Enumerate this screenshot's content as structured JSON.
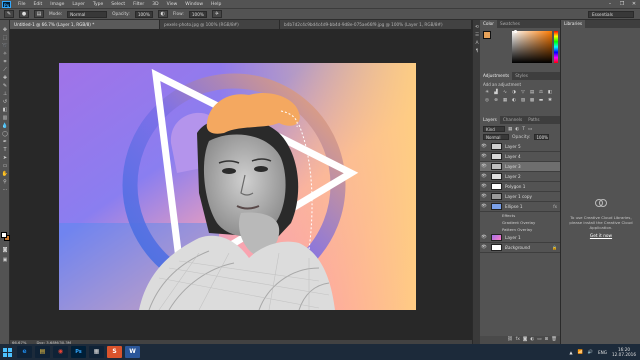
{
  "menubar": {
    "logo": "Ps",
    "items": [
      "File",
      "Edit",
      "Image",
      "Layer",
      "Type",
      "Select",
      "Filter",
      "3D",
      "View",
      "Window",
      "Help"
    ],
    "window_controls": [
      "–",
      "❐",
      "✕"
    ]
  },
  "options": {
    "mode_label": "Mode:",
    "mode_value": "Normal",
    "opacity_label": "Opacity:",
    "opacity_value": "100%",
    "flow_label": "Flow:",
    "flow_value": "100%",
    "workspace": "Essentials"
  },
  "tabs": [
    {
      "label": "Untitled-1 @ 66.7% (Layer 1, RGB/8) *",
      "active": true
    },
    {
      "label": "pexels-photo.jpg @ 100% (RGB/8#)",
      "active": false
    },
    {
      "label": "b4b7d2c4c9bd4c4d9-bb4d-9d8e-075ae66f9.jpg @ 100% (Layer 1, RGB/8#)",
      "active": false
    }
  ],
  "status": {
    "zoom": "66.67%",
    "doc_size": "Doc: 3.68M/30.3M"
  },
  "color_panel": {
    "tabs": [
      "Color",
      "Swatches"
    ],
    "fg_color": "#e8a35a"
  },
  "adjustments": {
    "tabs": [
      "Adjustments",
      "Styles"
    ],
    "title": "Add an adjustment"
  },
  "layers": {
    "tabs": [
      "Layers",
      "Channels",
      "Paths"
    ],
    "kind_label": "Kind",
    "blend_mode": "Normal",
    "opacity_label": "Opacity:",
    "opacity_value": "100%",
    "lock_label": "Lock:",
    "fill_label": "Fill:",
    "fill_value": "100%",
    "rows": [
      {
        "name": "Layer 5",
        "thumb": "#cfcfcf",
        "selected": false,
        "fx": ""
      },
      {
        "name": "Layer 4",
        "thumb": "#d8d8d8",
        "selected": false,
        "fx": ""
      },
      {
        "name": "Layer 3",
        "thumb": "#bdbdbd",
        "selected": true,
        "fx": ""
      },
      {
        "name": "Layer 2",
        "thumb": "#e0e0e0",
        "selected": false,
        "fx": ""
      },
      {
        "name": "Polygon 1",
        "thumb": "#ffffff",
        "selected": false,
        "fx": ""
      },
      {
        "name": "Layer 1 copy",
        "thumb": "#9a9a9a",
        "selected": false,
        "fx": ""
      },
      {
        "name": "Ellipse 1",
        "thumb": "#7aa0e8",
        "selected": false,
        "fx": "fx"
      }
    ],
    "effects_label": "Effects",
    "effects": [
      "Gradient Overlay",
      "Pattern Overlay"
    ],
    "rows_bottom": [
      {
        "name": "Layer 1",
        "thumb": "#c77fd6",
        "selected": false,
        "fx": ""
      },
      {
        "name": "Background",
        "thumb": "#ffffff",
        "selected": false,
        "fx": ""
      }
    ]
  },
  "libraries": {
    "tab": "Libraries",
    "message": "To use Creative Cloud Libraries, please install the Creative Cloud Application.",
    "link": "Get it now"
  },
  "taskbar": {
    "apps": [
      {
        "label": "e",
        "color": "#1e88e5",
        "bg": "#0f2236"
      },
      {
        "label": "▤",
        "color": "#f2c744",
        "bg": "#0f2236"
      },
      {
        "label": "◉",
        "color": "#e94335",
        "bg": "#0f2236"
      },
      {
        "label": "Ps",
        "color": "#31a8ff",
        "bg": "#001e36"
      },
      {
        "label": "▦",
        "color": "#dddddd",
        "bg": "#0f2236"
      },
      {
        "label": "S",
        "color": "#ffffff",
        "bg": "#d9532c"
      },
      {
        "label": "W",
        "color": "#ffffff",
        "bg": "#2b579a"
      }
    ],
    "lang": "ENG",
    "time": "16:20",
    "date": "12.07.2016"
  }
}
